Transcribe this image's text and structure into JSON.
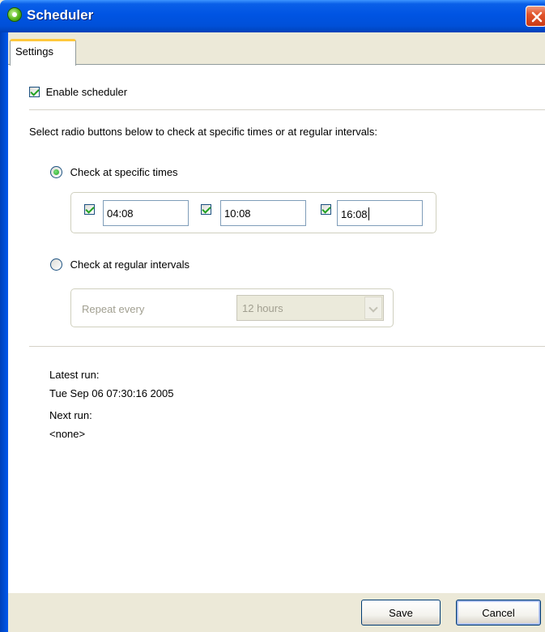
{
  "window": {
    "title": "Scheduler"
  },
  "tabs": [
    {
      "label": "Settings"
    }
  ],
  "enable": {
    "label": "Enable scheduler",
    "checked": true
  },
  "instructions": "Select radio buttons below to check at specific times or at regular intervals:",
  "specific": {
    "label": "Check at specific times",
    "selected": true,
    "times": [
      {
        "value": "04:08",
        "checked": true
      },
      {
        "value": "10:08",
        "checked": true
      },
      {
        "value": "16:08",
        "checked": true
      }
    ]
  },
  "intervals": {
    "label": "Check at regular intervals",
    "selected": false,
    "repeat_label": "Repeat every",
    "repeat_value": "12 hours"
  },
  "status": {
    "latest_label": "Latest run:",
    "latest_value": "Tue Sep 06 07:30:16 2005",
    "next_label": "Next run:",
    "next_value": "<none>"
  },
  "buttons": {
    "save": "Save",
    "cancel": "Cancel"
  },
  "colors": {
    "titlebar": "#0054e3",
    "accent_check": "#21a121",
    "tab_highlight": "#ffc83c"
  }
}
